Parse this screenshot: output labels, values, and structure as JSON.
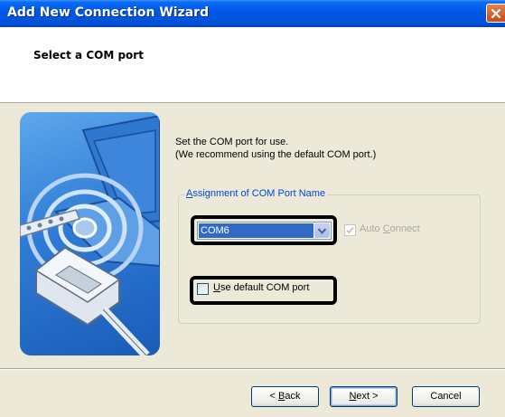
{
  "window": {
    "title": "Add New Connection Wizard"
  },
  "header": {
    "title": "Select a COM port"
  },
  "description": {
    "line1": "Set the COM port for use.",
    "line2": "(We recommend using the default COM port.)"
  },
  "group": {
    "legend_mnemonic": "A",
    "legend_rest": "ssignment of COM Port Name",
    "combo_value": "COM6",
    "auto_connect": {
      "pre": "Auto ",
      "mnemonic": "C",
      "post": "onnect",
      "checked": true,
      "enabled": false
    },
    "default_port": {
      "mnemonic": "U",
      "post": "se default COM port",
      "checked": false
    }
  },
  "buttons": {
    "back": {
      "pre": "< ",
      "mnemonic": "B",
      "post": "ack"
    },
    "next": {
      "mnemonic": "N",
      "post": "ext >"
    },
    "cancel": {
      "label": "Cancel"
    }
  },
  "icons": [
    "close-icon",
    "dropdown-arrow-icon",
    "checkmark-icon",
    "connection-illustration"
  ],
  "colors": {
    "titlebar": "#0055e0",
    "selection": "#316ac5",
    "group_legend": "#0046d5",
    "dialog_bg": "#ece9d8"
  }
}
